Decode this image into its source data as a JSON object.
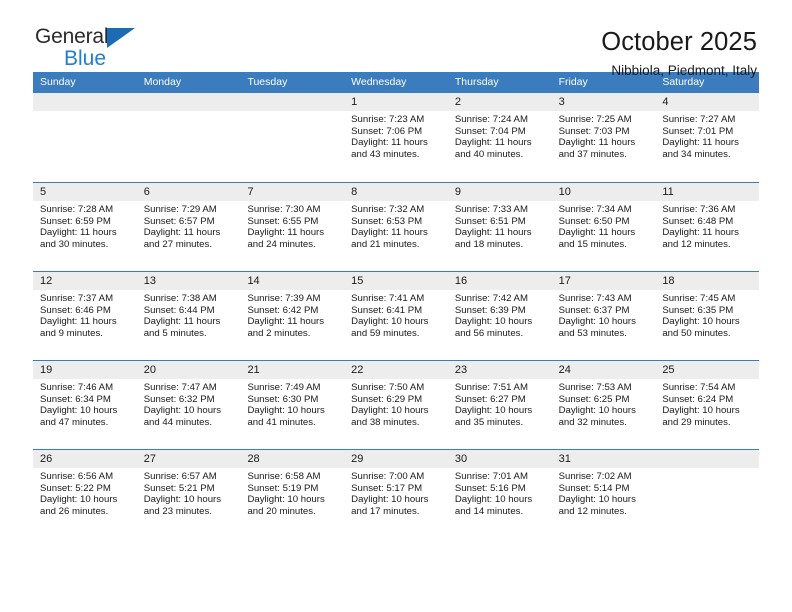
{
  "brand": {
    "line1": "General",
    "line2": "Blue",
    "triangle_color": "#1b6cb3",
    "blue_text_color": "#1f7fd0"
  },
  "header": {
    "title": "October 2025",
    "subtitle": "Nibbiola, Piedmont, Italy"
  },
  "theme": {
    "header_blue": "#3a7cbe",
    "date_band_gray": "#ededed",
    "text_color": "#1a1a1a"
  },
  "weekdays": [
    "Sunday",
    "Monday",
    "Tuesday",
    "Wednesday",
    "Thursday",
    "Friday",
    "Saturday"
  ],
  "weeks": [
    [
      {
        "day": "",
        "empty": true
      },
      {
        "day": "",
        "empty": true
      },
      {
        "day": "",
        "empty": true
      },
      {
        "day": "1",
        "sunrise": "Sunrise: 7:23 AM",
        "sunset": "Sunset: 7:06 PM",
        "daylight_line1": "Daylight: 11 hours",
        "daylight_line2": "and 43 minutes."
      },
      {
        "day": "2",
        "sunrise": "Sunrise: 7:24 AM",
        "sunset": "Sunset: 7:04 PM",
        "daylight_line1": "Daylight: 11 hours",
        "daylight_line2": "and 40 minutes."
      },
      {
        "day": "3",
        "sunrise": "Sunrise: 7:25 AM",
        "sunset": "Sunset: 7:03 PM",
        "daylight_line1": "Daylight: 11 hours",
        "daylight_line2": "and 37 minutes."
      },
      {
        "day": "4",
        "sunrise": "Sunrise: 7:27 AM",
        "sunset": "Sunset: 7:01 PM",
        "daylight_line1": "Daylight: 11 hours",
        "daylight_line2": "and 34 minutes."
      }
    ],
    [
      {
        "day": "5",
        "sunrise": "Sunrise: 7:28 AM",
        "sunset": "Sunset: 6:59 PM",
        "daylight_line1": "Daylight: 11 hours",
        "daylight_line2": "and 30 minutes."
      },
      {
        "day": "6",
        "sunrise": "Sunrise: 7:29 AM",
        "sunset": "Sunset: 6:57 PM",
        "daylight_line1": "Daylight: 11 hours",
        "daylight_line2": "and 27 minutes."
      },
      {
        "day": "7",
        "sunrise": "Sunrise: 7:30 AM",
        "sunset": "Sunset: 6:55 PM",
        "daylight_line1": "Daylight: 11 hours",
        "daylight_line2": "and 24 minutes."
      },
      {
        "day": "8",
        "sunrise": "Sunrise: 7:32 AM",
        "sunset": "Sunset: 6:53 PM",
        "daylight_line1": "Daylight: 11 hours",
        "daylight_line2": "and 21 minutes."
      },
      {
        "day": "9",
        "sunrise": "Sunrise: 7:33 AM",
        "sunset": "Sunset: 6:51 PM",
        "daylight_line1": "Daylight: 11 hours",
        "daylight_line2": "and 18 minutes."
      },
      {
        "day": "10",
        "sunrise": "Sunrise: 7:34 AM",
        "sunset": "Sunset: 6:50 PM",
        "daylight_line1": "Daylight: 11 hours",
        "daylight_line2": "and 15 minutes."
      },
      {
        "day": "11",
        "sunrise": "Sunrise: 7:36 AM",
        "sunset": "Sunset: 6:48 PM",
        "daylight_line1": "Daylight: 11 hours",
        "daylight_line2": "and 12 minutes."
      }
    ],
    [
      {
        "day": "12",
        "sunrise": "Sunrise: 7:37 AM",
        "sunset": "Sunset: 6:46 PM",
        "daylight_line1": "Daylight: 11 hours",
        "daylight_line2": "and 9 minutes."
      },
      {
        "day": "13",
        "sunrise": "Sunrise: 7:38 AM",
        "sunset": "Sunset: 6:44 PM",
        "daylight_line1": "Daylight: 11 hours",
        "daylight_line2": "and 5 minutes."
      },
      {
        "day": "14",
        "sunrise": "Sunrise: 7:39 AM",
        "sunset": "Sunset: 6:42 PM",
        "daylight_line1": "Daylight: 11 hours",
        "daylight_line2": "and 2 minutes."
      },
      {
        "day": "15",
        "sunrise": "Sunrise: 7:41 AM",
        "sunset": "Sunset: 6:41 PM",
        "daylight_line1": "Daylight: 10 hours",
        "daylight_line2": "and 59 minutes."
      },
      {
        "day": "16",
        "sunrise": "Sunrise: 7:42 AM",
        "sunset": "Sunset: 6:39 PM",
        "daylight_line1": "Daylight: 10 hours",
        "daylight_line2": "and 56 minutes."
      },
      {
        "day": "17",
        "sunrise": "Sunrise: 7:43 AM",
        "sunset": "Sunset: 6:37 PM",
        "daylight_line1": "Daylight: 10 hours",
        "daylight_line2": "and 53 minutes."
      },
      {
        "day": "18",
        "sunrise": "Sunrise: 7:45 AM",
        "sunset": "Sunset: 6:35 PM",
        "daylight_line1": "Daylight: 10 hours",
        "daylight_line2": "and 50 minutes."
      }
    ],
    [
      {
        "day": "19",
        "sunrise": "Sunrise: 7:46 AM",
        "sunset": "Sunset: 6:34 PM",
        "daylight_line1": "Daylight: 10 hours",
        "daylight_line2": "and 47 minutes."
      },
      {
        "day": "20",
        "sunrise": "Sunrise: 7:47 AM",
        "sunset": "Sunset: 6:32 PM",
        "daylight_line1": "Daylight: 10 hours",
        "daylight_line2": "and 44 minutes."
      },
      {
        "day": "21",
        "sunrise": "Sunrise: 7:49 AM",
        "sunset": "Sunset: 6:30 PM",
        "daylight_line1": "Daylight: 10 hours",
        "daylight_line2": "and 41 minutes."
      },
      {
        "day": "22",
        "sunrise": "Sunrise: 7:50 AM",
        "sunset": "Sunset: 6:29 PM",
        "daylight_line1": "Daylight: 10 hours",
        "daylight_line2": "and 38 minutes."
      },
      {
        "day": "23",
        "sunrise": "Sunrise: 7:51 AM",
        "sunset": "Sunset: 6:27 PM",
        "daylight_line1": "Daylight: 10 hours",
        "daylight_line2": "and 35 minutes."
      },
      {
        "day": "24",
        "sunrise": "Sunrise: 7:53 AM",
        "sunset": "Sunset: 6:25 PM",
        "daylight_line1": "Daylight: 10 hours",
        "daylight_line2": "and 32 minutes."
      },
      {
        "day": "25",
        "sunrise": "Sunrise: 7:54 AM",
        "sunset": "Sunset: 6:24 PM",
        "daylight_line1": "Daylight: 10 hours",
        "daylight_line2": "and 29 minutes."
      }
    ],
    [
      {
        "day": "26",
        "sunrise": "Sunrise: 6:56 AM",
        "sunset": "Sunset: 5:22 PM",
        "daylight_line1": "Daylight: 10 hours",
        "daylight_line2": "and 26 minutes."
      },
      {
        "day": "27",
        "sunrise": "Sunrise: 6:57 AM",
        "sunset": "Sunset: 5:21 PM",
        "daylight_line1": "Daylight: 10 hours",
        "daylight_line2": "and 23 minutes."
      },
      {
        "day": "28",
        "sunrise": "Sunrise: 6:58 AM",
        "sunset": "Sunset: 5:19 PM",
        "daylight_line1": "Daylight: 10 hours",
        "daylight_line2": "and 20 minutes."
      },
      {
        "day": "29",
        "sunrise": "Sunrise: 7:00 AM",
        "sunset": "Sunset: 5:17 PM",
        "daylight_line1": "Daylight: 10 hours",
        "daylight_line2": "and 17 minutes."
      },
      {
        "day": "30",
        "sunrise": "Sunrise: 7:01 AM",
        "sunset": "Sunset: 5:16 PM",
        "daylight_line1": "Daylight: 10 hours",
        "daylight_line2": "and 14 minutes."
      },
      {
        "day": "31",
        "sunrise": "Sunrise: 7:02 AM",
        "sunset": "Sunset: 5:14 PM",
        "daylight_line1": "Daylight: 10 hours",
        "daylight_line2": "and 12 minutes."
      },
      {
        "day": "",
        "empty": true
      }
    ]
  ]
}
